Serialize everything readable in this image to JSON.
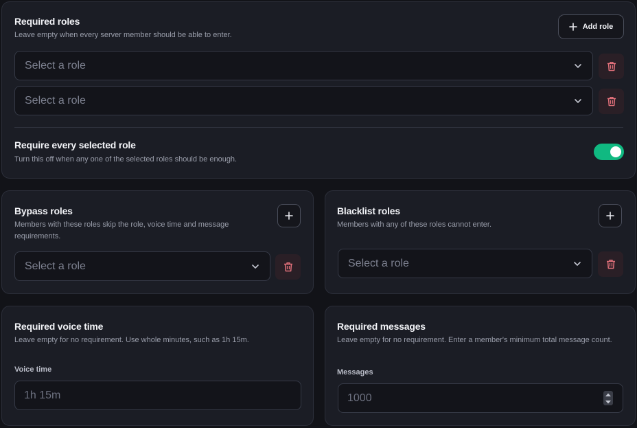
{
  "required_roles": {
    "title": "Required roles",
    "description": "Leave empty when every server member should be able to enter.",
    "add_button_label": "Add role",
    "selects": [
      "Select a role",
      "Select a role"
    ],
    "toggle": {
      "title": "Require every selected role",
      "description": "Turn this off when any one of the selected roles should be enough.",
      "on": true
    }
  },
  "bypass_roles": {
    "title": "Bypass roles",
    "description": "Members with these roles skip the role, voice time and message requirements.",
    "select_placeholder": "Select a role"
  },
  "blacklist_roles": {
    "title": "Blacklist roles",
    "description": "Members with any of these roles cannot enter.",
    "select_placeholder": "Select a role"
  },
  "voice_time": {
    "title": "Required voice time",
    "description": "Leave empty for no requirement. Use whole minutes, such as 1h 15m.",
    "field_label": "Voice time",
    "placeholder": "1h 15m"
  },
  "messages": {
    "title": "Required messages",
    "description": "Leave empty for no requirement. Enter a member's minimum total message count.",
    "field_label": "Messages",
    "placeholder": "1000"
  },
  "colors": {
    "toggle_on": "#10b981",
    "trash_icon": "#e0707a",
    "card_bg": "#1b1d25",
    "page_bg": "#121318"
  },
  "icons": {
    "plus": "plus-icon",
    "trash": "trash-icon",
    "chevron": "chevron-down-icon"
  }
}
